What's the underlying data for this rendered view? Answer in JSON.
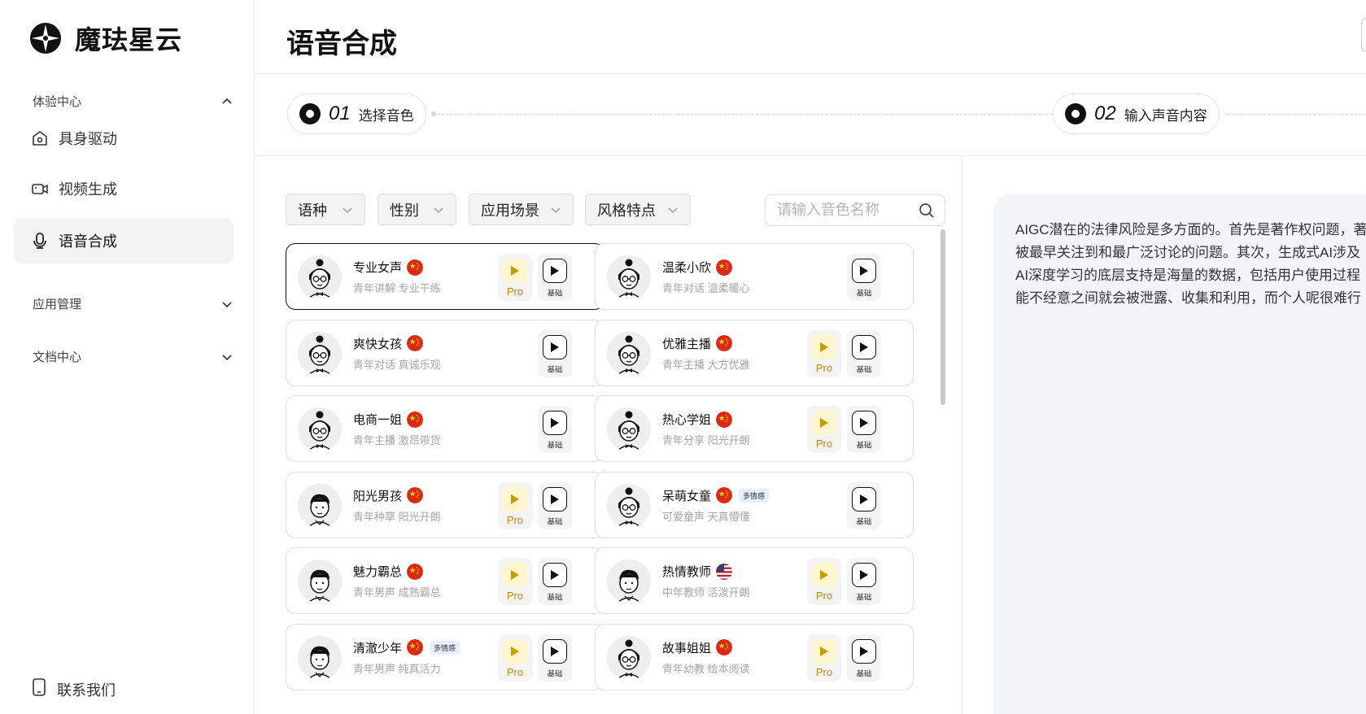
{
  "brand": {
    "name": "魔珐星云"
  },
  "sidebar": {
    "sections": [
      {
        "label": "体验中心",
        "expanded": true
      },
      {
        "label": "应用管理",
        "expanded": false
      },
      {
        "label": "文档中心",
        "expanded": false
      }
    ],
    "items": [
      {
        "label": "具身驱动",
        "icon": "home-camera-icon"
      },
      {
        "label": "视频生成",
        "icon": "video-camera-icon"
      },
      {
        "label": "语音合成",
        "icon": "microphone-icon",
        "active": true
      }
    ],
    "contact": {
      "label": "联系我们",
      "icon": "phone-icon"
    }
  },
  "header": {
    "title": "语音合成"
  },
  "steps": [
    {
      "num": "01",
      "label": "选择音色"
    },
    {
      "num": "02",
      "label": "输入声音内容"
    }
  ],
  "filters": [
    {
      "label": "语种"
    },
    {
      "label": "性别"
    },
    {
      "label": "应用场景"
    },
    {
      "label": "风格特点"
    }
  ],
  "search": {
    "placeholder": "请输入音色名称",
    "value": ""
  },
  "voices": [
    {
      "name": "专业女声",
      "desc": "青年讲解 专业干练",
      "gender": "female",
      "flag": "cn",
      "pro": true,
      "basic_label": "基础",
      "pro_label": "Pro",
      "selected": true
    },
    {
      "name": "温柔小欣",
      "desc": "青年对话 温柔暖心",
      "gender": "female",
      "flag": "cn",
      "pro": false,
      "basic_label": "基础"
    },
    {
      "name": "爽快女孩",
      "desc": "青年对话 真诚乐观",
      "gender": "female",
      "flag": "cn",
      "pro": false,
      "basic_label": "基础"
    },
    {
      "name": "优雅主播",
      "desc": "青年主播 大方优雅",
      "gender": "female",
      "flag": "cn",
      "pro": true,
      "basic_label": "基础",
      "pro_label": "Pro"
    },
    {
      "name": "电商一姐",
      "desc": "青年主播 激昂带货",
      "gender": "female",
      "flag": "cn",
      "pro": false,
      "basic_label": "基础"
    },
    {
      "name": "热心学姐",
      "desc": "青年分享 阳光开朗",
      "gender": "female",
      "flag": "cn",
      "pro": true,
      "basic_label": "基础",
      "pro_label": "Pro"
    },
    {
      "name": "阳光男孩",
      "desc": "青年种草 阳光开朗",
      "gender": "male",
      "flag": "cn",
      "pro": true,
      "basic_label": "基础",
      "pro_label": "Pro"
    },
    {
      "name": "呆萌女童",
      "desc": "可爱童声 天真懵懂",
      "gender": "female",
      "flag": "cn",
      "tag": "多情感",
      "pro": false,
      "basic_label": "基础"
    },
    {
      "name": "魅力霸总",
      "desc": "青年男声 成熟霸总",
      "gender": "male",
      "flag": "cn",
      "pro": true,
      "basic_label": "基础",
      "pro_label": "Pro"
    },
    {
      "name": "热情教师",
      "desc": "中年教师 活泼开朗",
      "gender": "male",
      "flag": "us",
      "pro": true,
      "basic_label": "基础",
      "pro_label": "Pro"
    },
    {
      "name": "清澈少年",
      "desc": "青年男声 纯真活力",
      "gender": "male",
      "flag": "cn",
      "tag": "多情感",
      "pro": true,
      "basic_label": "基础",
      "pro_label": "Pro"
    },
    {
      "name": "故事姐姐",
      "desc": "青年幼教 绘本阅读",
      "gender": "female",
      "flag": "cn",
      "pro": true,
      "basic_label": "基础",
      "pro_label": "Pro"
    }
  ],
  "content": {
    "lines": [
      "AIGC潜在的法律风险是多方面的。首先是著作权问题，著",
      "被最早关注到和最广泛讨论的问题。其次，生成式AI涉及",
      "AI深度学习的底层支持是海量的数据，包括用户使用过程",
      "能不经意之间就会被泄露、收集和利用，而个人呢很难行"
    ]
  }
}
